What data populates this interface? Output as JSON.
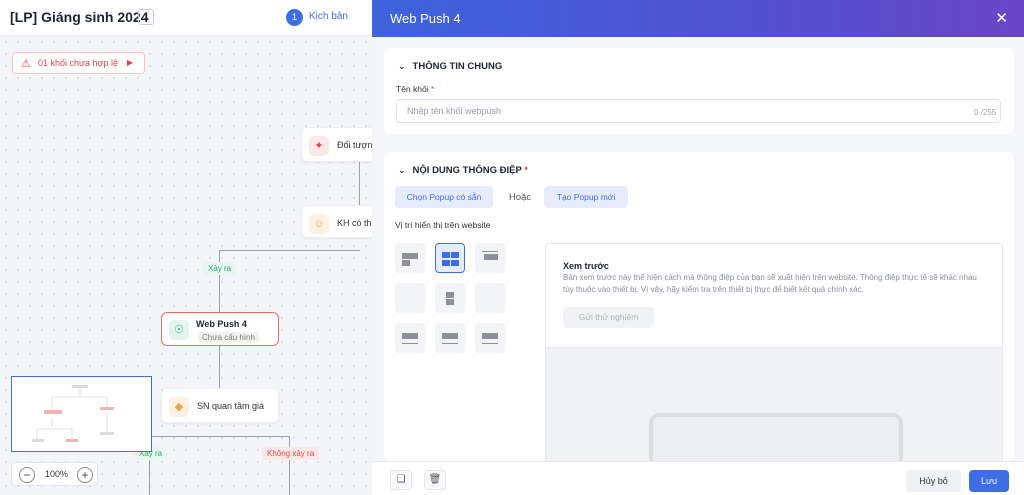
{
  "project": {
    "title": "[LP] Giáng sinh 2024",
    "step_number": "1",
    "step_label": "Kịch bản"
  },
  "alert": {
    "text": "01 khối chưa hợp lệ"
  },
  "flow": {
    "node_doi_tuong": "Đối tượng",
    "node_kh": "KH có thô",
    "tag_xay_ra_1": "Xảy ra",
    "webpush_title": "Web Push 4",
    "webpush_status": "Chưa cấu hình",
    "node_sn": "SN quan tâm giá",
    "tag_xay_ra_2": "Xảy ra",
    "tag_khong_xay_ra": "Không xảy ra"
  },
  "zoom": {
    "value": "100%"
  },
  "panel": {
    "title": "Web Push 4",
    "section_general": {
      "title": "THÔNG TIN CHUNG",
      "name_label": "Tên khối",
      "name_placeholder": "Nhập tên khối webpush",
      "name_value": "",
      "counter": "0 /255"
    },
    "section_content": {
      "title": "NỘI DUNG THÔNG ĐIỆP",
      "btn_choose": "Chọn Popup có sẵn",
      "or_text": "Hoặc",
      "btn_create": "Tạo Popup mới",
      "position_label": "Vị trí hiển thị trên website",
      "selected_position": "top-center",
      "preview": {
        "title": "Xem trước",
        "desc": "Bản xem trước này thể hiện cách mà thông điệp của bạn sẽ xuất hiện trên website. Thông điệp thực tế sẽ khác nhau tùy thuộc vào thiết bị. Vì vậy, hãy kiểm tra trên thiết bị thực để biết kết quả chính xác.",
        "test_button": "Gửi thử nghiệm"
      }
    },
    "footer": {
      "cancel": "Hủy bỏ",
      "save": "Lưu"
    }
  },
  "colors": {
    "primary": "#3e6ee6",
    "error": "#e04646",
    "success": "#27a27b"
  }
}
